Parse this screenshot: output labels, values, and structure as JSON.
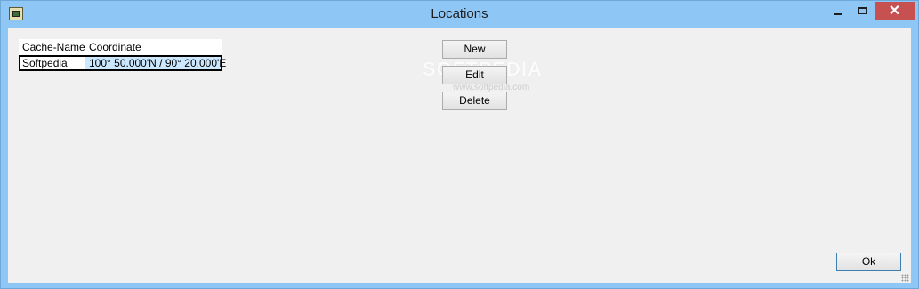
{
  "window": {
    "title": "Locations"
  },
  "titlebar": {
    "close_glyph": "✕"
  },
  "grid": {
    "columns": [
      "Cache-Name",
      "Coordinate"
    ],
    "rows": [
      {
        "name": "Softpedia",
        "coordinate": "100° 50.000'N / 90° 20.000'E"
      }
    ]
  },
  "buttons": {
    "new": "New",
    "edit": "Edit",
    "delete": "Delete",
    "ok": "Ok"
  },
  "watermark": {
    "brand": "SOFTPEDIA",
    "url": "www.softpedia.com"
  }
}
